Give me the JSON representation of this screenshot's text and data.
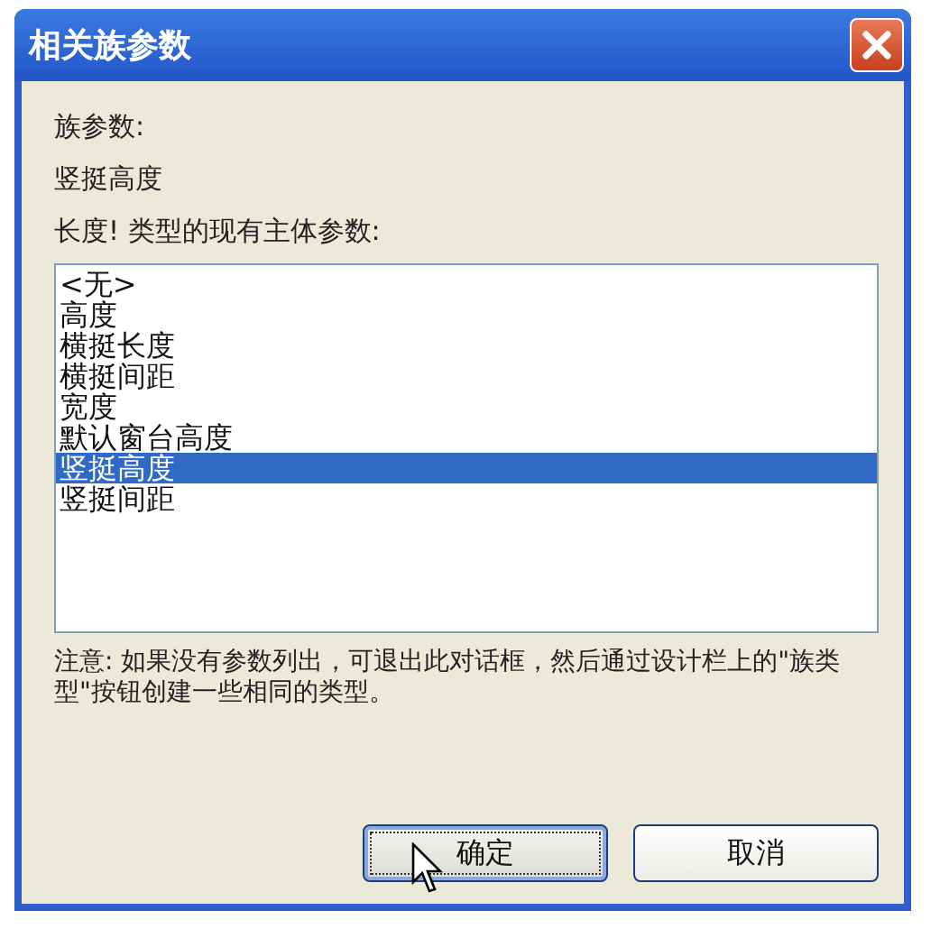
{
  "window": {
    "title": "相关族参数"
  },
  "family_parameter_label": "族参数:",
  "family_parameter_value": "竖挺高度",
  "list_label": "长度! 类型的现有主体参数:",
  "parameters": [
    {
      "label": "<无>",
      "selected": false
    },
    {
      "label": "高度",
      "selected": false
    },
    {
      "label": "横挺长度",
      "selected": false
    },
    {
      "label": "横挺间距",
      "selected": false
    },
    {
      "label": "宽度",
      "selected": false
    },
    {
      "label": "默认窗台高度",
      "selected": false
    },
    {
      "label": "竖挺高度",
      "selected": true
    },
    {
      "label": "竖挺间距",
      "selected": false
    }
  ],
  "note": "注意: 如果没有参数列出，可退出此对话框，然后通过设计栏上的\"族类型\"按钮创建一些相同的类型。",
  "buttons": [
    {
      "label": "确定",
      "default": true
    },
    {
      "label": "取消",
      "default": false
    }
  ]
}
